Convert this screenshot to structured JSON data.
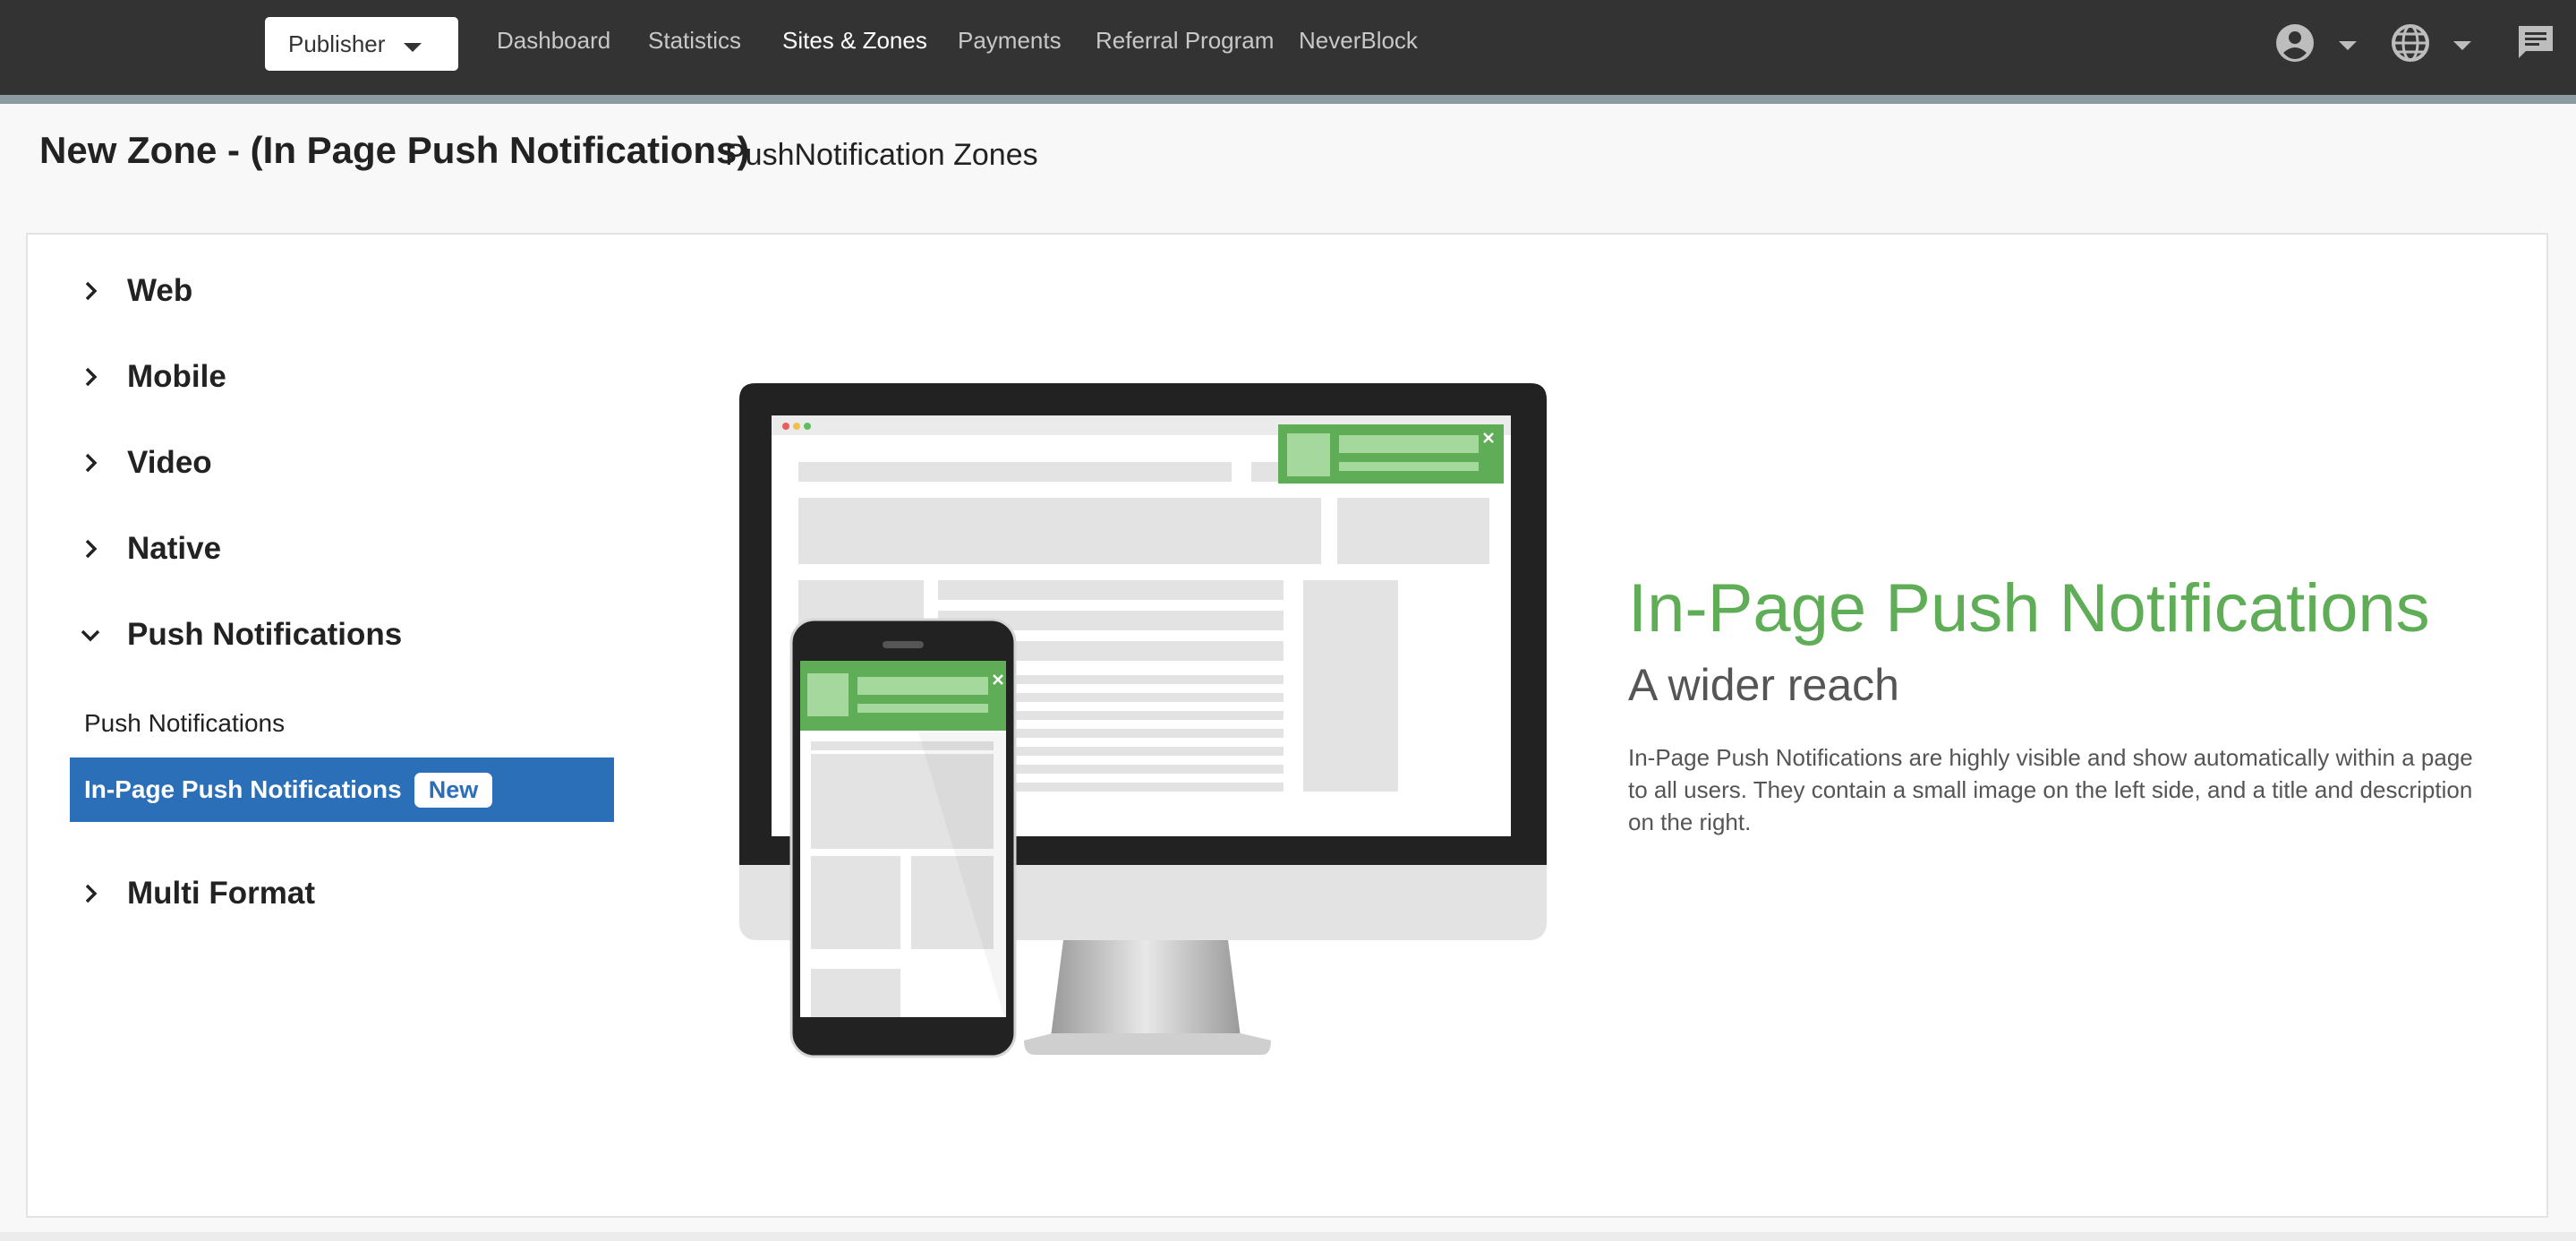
{
  "nav": {
    "role_selector": "Publisher",
    "links": [
      "Dashboard",
      "Statistics",
      "Sites & Zones",
      "Payments",
      "Referral Program",
      "NeverBlock"
    ],
    "active_link": "Sites & Zones"
  },
  "header": {
    "title": "New Zone - (In Page Push Notifications)",
    "subtitle": "PushNotification Zones"
  },
  "categories": [
    {
      "label": "Web",
      "expanded": false
    },
    {
      "label": "Mobile",
      "expanded": false
    },
    {
      "label": "Video",
      "expanded": false
    },
    {
      "label": "Native",
      "expanded": false
    },
    {
      "label": "Push Notifications",
      "expanded": true
    },
    {
      "label": "Multi Format",
      "expanded": false
    }
  ],
  "push_sub_items": {
    "item1": "Push Notifications",
    "item2": "In-Page Push Notifications",
    "item2_badge": "New"
  },
  "feature": {
    "title": "In-Page Push Notifications",
    "subtitle": "A wider reach",
    "description": "In-Page Push Notifications are highly visible and show automatically within a page to all users. They contain a small image on the left side, and a title and description on the right."
  },
  "colors": {
    "nav_bg": "#333333",
    "active_item": "#2a6fb8",
    "accent_green": "#5fad56"
  },
  "icons": [
    "account-icon",
    "globe-icon",
    "chat-icon",
    "chevron-right-icon",
    "chevron-down-icon",
    "close-icon"
  ]
}
